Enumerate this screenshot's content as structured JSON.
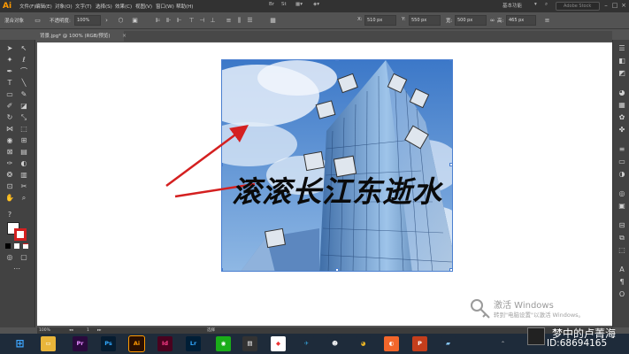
{
  "app": {
    "logo": "Ai"
  },
  "menu": {
    "items": [
      "文件(F)",
      "编辑(E)",
      "对象(O)",
      "文字(T)",
      "选择(S)",
      "效果(C)",
      "视图(V)",
      "窗口(W)",
      "帮助(H)"
    ]
  },
  "menubar_right": {
    "workspace": "基本功能",
    "search_placeholder": "Adobe Stock"
  },
  "control": {
    "no_selection": "混合对象",
    "opacity_label": "不透明度:",
    "opacity_value": "100%",
    "x_label": "X:",
    "x_value": "510 px",
    "y_label": "Y:",
    "y_value": "550 px",
    "w_label": "宽:",
    "w_value": "500 px",
    "h_label": "高:",
    "h_value": "465 px"
  },
  "document_tab": {
    "title": "背景.jpg* @ 100% (RGB/预览)",
    "close": "×"
  },
  "artwork": {
    "overlay_text": "滚滚长江东逝水"
  },
  "status": {
    "zoom": "100%",
    "page": "1",
    "tool": "选择"
  },
  "activate_windows": {
    "line1": "激活 Windows",
    "line2": "转到\"电脑设置\"以激活 Windows。"
  },
  "watermark": {
    "line1": "梦中的卢菁海",
    "line2": "ID:68694165"
  },
  "colors": {
    "accent": "#4a7fd0",
    "ai_orange": "#ff9a00",
    "arrow_red": "#d42020"
  },
  "taskbar": {
    "apps": [
      {
        "icon": "windows-start-icon"
      },
      {
        "icon": "file-explorer-icon"
      },
      {
        "icon": "premiere-icon",
        "text": "Pr"
      },
      {
        "icon": "photoshop-icon",
        "text": "Ps"
      },
      {
        "icon": "illustrator-icon",
        "text": "Ai"
      },
      {
        "icon": "indesign-icon",
        "text": "Id"
      },
      {
        "icon": "lightroom-icon",
        "text": "Lr"
      },
      {
        "icon": "wechat-icon"
      },
      {
        "icon": "video-player-icon"
      },
      {
        "icon": "app-icon"
      },
      {
        "icon": "qq-icon"
      },
      {
        "icon": "chrome-icon"
      },
      {
        "icon": "media-icon"
      },
      {
        "icon": "powerpoint-icon"
      },
      {
        "icon": "app2-icon"
      }
    ]
  }
}
